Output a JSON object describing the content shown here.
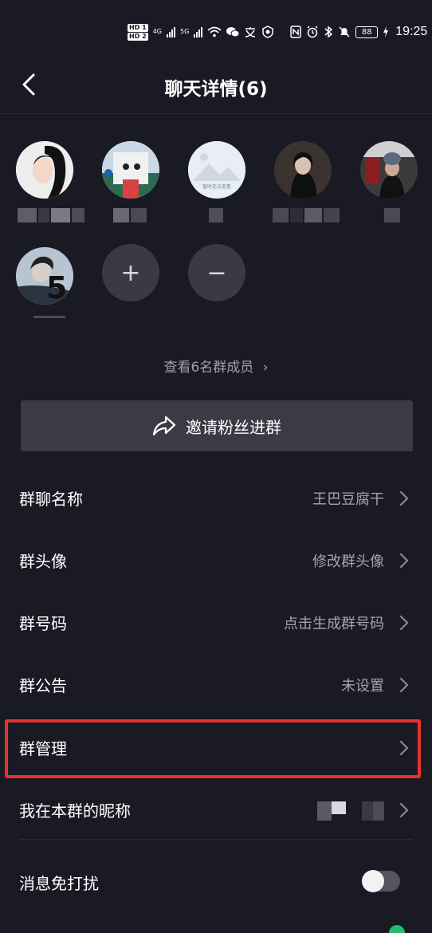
{
  "status_bar": {
    "hd1": "HD 1",
    "hd2": "HD 2",
    "net1": "4G",
    "net2": "5G",
    "battery": "88",
    "time": "19:25"
  },
  "header": {
    "title": "聊天详情(6)"
  },
  "members": [
    {
      "name": "member-1"
    },
    {
      "name": "member-2"
    },
    {
      "name": "member-3",
      "avatar_text": "暂时无法查看"
    },
    {
      "name": "member-4"
    },
    {
      "name": "member-5"
    },
    {
      "name": "member-6"
    }
  ],
  "add_label": "+",
  "remove_label": "−",
  "view_members": "查看6名群成员",
  "view_chevron": "›",
  "invite_label": "邀请粉丝进群",
  "settings": [
    {
      "label": "群聊名称",
      "value": "王巴豆腐干"
    },
    {
      "label": "群头像",
      "value": "修改群头像"
    },
    {
      "label": "群号码",
      "value": "点击生成群号码"
    },
    {
      "label": "群公告",
      "value": "未设置"
    },
    {
      "label": "群管理",
      "value": ""
    },
    {
      "label": "我在本群的昵称",
      "value": ""
    }
  ],
  "dnd": {
    "label": "消息免打扰",
    "enabled": false
  },
  "colors": {
    "background": "#1a1a25",
    "highlight": "#e6332e",
    "muted": "#a4a4ae"
  }
}
